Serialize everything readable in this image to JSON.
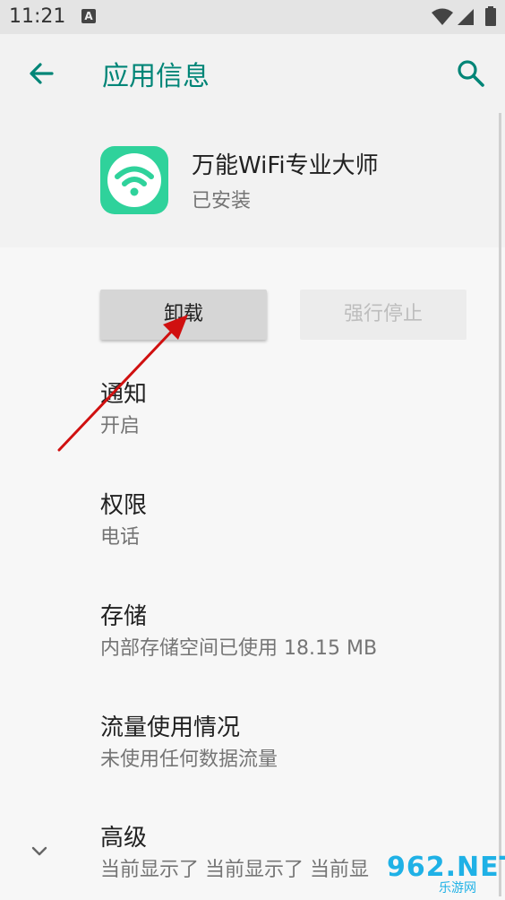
{
  "status_bar": {
    "time": "11:21",
    "a_glyph": "A"
  },
  "toolbar": {
    "title": "应用信息"
  },
  "app": {
    "name": "万能WiFi专业大师",
    "status": "已安装"
  },
  "buttons": {
    "uninstall": "卸载",
    "force_stop": "强行停止"
  },
  "items": [
    {
      "title": "通知",
      "subtitle": "开启"
    },
    {
      "title": "权限",
      "subtitle": "电话"
    },
    {
      "title": "存储",
      "subtitle": "内部存储空间已使用 18.15 MB"
    },
    {
      "title": "流量使用情况",
      "subtitle": "未使用任何数据流量"
    },
    {
      "title": "高级",
      "subtitle": "当前显示了 当前显示了 当前显"
    }
  ],
  "watermark": {
    "logo": "962.NET",
    "sub": "乐游网"
  },
  "colors": {
    "accent": "#008577",
    "app_icon": "#2fd29b",
    "annotation_arrow": "#d01010"
  }
}
